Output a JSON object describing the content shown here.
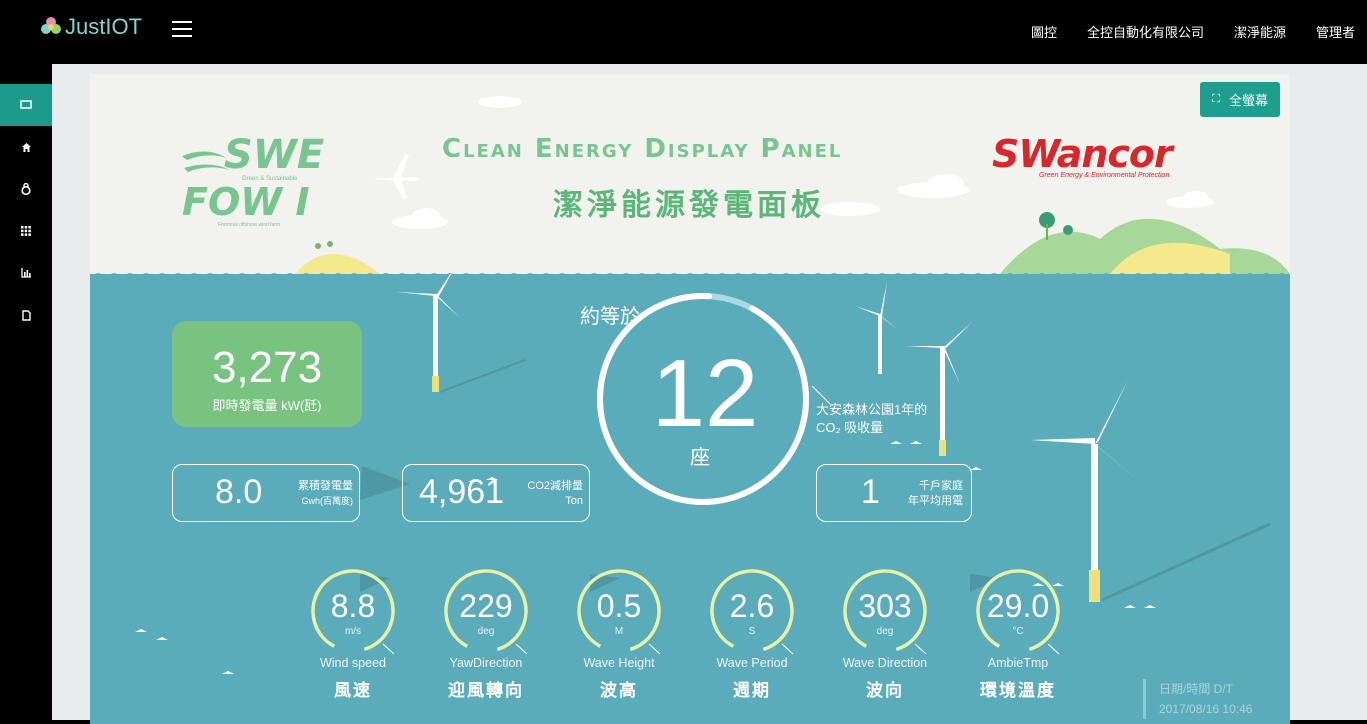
{
  "app": {
    "name": "JustIOT"
  },
  "topnav": [
    "圖控",
    "全控自動化有限公司",
    "潔淨能源",
    "管理者"
  ],
  "sidebar": [
    {
      "icon": "monitor-icon"
    },
    {
      "icon": "home-icon"
    },
    {
      "icon": "lock-icon"
    },
    {
      "icon": "grid-icon"
    },
    {
      "icon": "bar-chart-icon"
    },
    {
      "icon": "document-icon"
    }
  ],
  "panel": {
    "fullscreen_label": "全螢幕",
    "title_en": "Clean Energy Display  Panel",
    "title_zh": "潔淨能源發電面板",
    "swe_logo": {
      "line1": "SWE",
      "line2": "FOW I",
      "sub": "Green & Sustainable",
      "tag": "Formosa offshore wind farm"
    },
    "swancor_logo": {
      "name": "SWancor",
      "tag": "Green Energy & Environmental Protection"
    },
    "realtime": {
      "value": "3,273",
      "label": "即時發電量 kW(瓩)"
    },
    "cumulative": {
      "value": "8.0",
      "unit1": "累積發電量",
      "unit2": "Gwh(百萬度)"
    },
    "co2": {
      "value": "4,961",
      "unit1": "CO2減排量",
      "unit2": "Ton"
    },
    "center": {
      "prefix": "約等於",
      "value": "12",
      "unit": "座",
      "note1": "大安森林公園1年的",
      "note2": "CO₂ 吸收量",
      "progress": 0.93
    },
    "households": {
      "value": "1",
      "unit1": "千戶家庭",
      "unit2": "年平均用電"
    },
    "gauges": [
      {
        "value": "8.8",
        "unit": "m/s",
        "en": "Wind speed",
        "zh": "風速"
      },
      {
        "value": "229",
        "unit": "deg",
        "en": "YawDirection",
        "zh": "迎風轉向"
      },
      {
        "value": "0.5",
        "unit": "M",
        "en": "Wave Height",
        "zh": "波高"
      },
      {
        "value": "2.6",
        "unit": "S",
        "en": "Wave Period",
        "zh": "週期"
      },
      {
        "value": "303",
        "unit": "deg",
        "en": "Wave Direction",
        "zh": "波向"
      },
      {
        "value": "29.0",
        "unit": "°C",
        "en": "AmbieTmp",
        "zh": "環境溫度"
      }
    ],
    "datetime": {
      "label": "日期/時間 D/T",
      "value": "2017/08/16 10:46"
    }
  },
  "colors": {
    "accent": "#1f9e8e",
    "sea": "#5aacba",
    "green_card": "#79c381",
    "gauge_ring": "#e6f2a8"
  }
}
